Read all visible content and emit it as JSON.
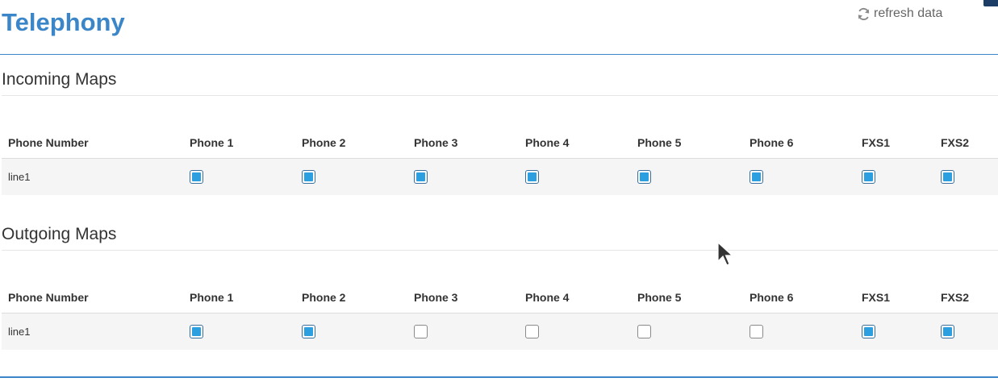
{
  "header": {
    "title": "Telephony",
    "refresh_label": "refresh data"
  },
  "incoming": {
    "title": "Incoming Maps",
    "columns": [
      "Phone Number",
      "Phone 1",
      "Phone 2",
      "Phone 3",
      "Phone 4",
      "Phone 5",
      "Phone 6",
      "FXS1",
      "FXS2"
    ],
    "rows": [
      {
        "number": "line1",
        "checks": [
          true,
          true,
          true,
          true,
          true,
          true,
          true,
          true
        ]
      }
    ]
  },
  "outgoing": {
    "title": "Outgoing Maps",
    "columns": [
      "Phone Number",
      "Phone 1",
      "Phone 2",
      "Phone 3",
      "Phone 4",
      "Phone 5",
      "Phone 6",
      "FXS1",
      "FXS2"
    ],
    "rows": [
      {
        "number": "line1",
        "checks": [
          true,
          true,
          false,
          false,
          false,
          false,
          true,
          true
        ]
      }
    ]
  },
  "colors": {
    "title_blue": "#3a86c8",
    "checkbox_fill": "#2c9fe0"
  }
}
